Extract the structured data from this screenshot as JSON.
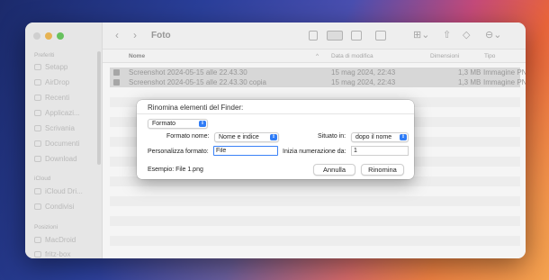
{
  "window": {
    "title": "Foto",
    "traffic_lights": [
      "close",
      "minimize",
      "zoom"
    ]
  },
  "sidebar": {
    "sections": [
      {
        "label": "Preferiti",
        "items": [
          "Setapp",
          "AirDrop",
          "Recenti",
          "Applicazi...",
          "Scrivania",
          "Documenti",
          "Download"
        ]
      },
      {
        "label": "iCloud",
        "items": [
          "iCloud Dri...",
          "Condivisi"
        ]
      },
      {
        "label": "Posizioni",
        "items": [
          "MacDroid",
          "fritz-box"
        ]
      }
    ]
  },
  "toolbar": {
    "back_icon": "chevron-left-icon",
    "forward_icon": "chevron-right-icon",
    "view_icons": [
      "icon-view-icon",
      "list-view-icon",
      "column-view-icon",
      "gallery-view-icon",
      "group-icon",
      "share-icon",
      "tag-icon",
      "more-icon",
      "search-icon"
    ]
  },
  "list": {
    "columns": [
      "Nome",
      "Data di modifica",
      "Dimensioni",
      "Tipo"
    ],
    "rows": [
      {
        "name": "Screenshot 2024-05-15 alle 22.43.30",
        "date": "15 mag 2024, 22:43",
        "size": "1,3 MB",
        "kind": "Immagine PNG"
      },
      {
        "name": "Screenshot 2024-05-15 alle 22.43.30 copia",
        "date": "15 mag 2024, 22:43",
        "size": "1,3 MB",
        "kind": "Immagine PNG"
      }
    ]
  },
  "dialog": {
    "title": "Rinomina elementi del Finder:",
    "mode_value": "Formato",
    "format_name_label": "Formato nome:",
    "format_name_value": "Nome e indice",
    "where_label": "Situato in:",
    "where_value": "dopo il nome",
    "custom_format_label": "Personalizza formato:",
    "custom_format_value": "File",
    "start_numbering_label": "Inizia numerazione da:",
    "start_numbering_value": "1",
    "example_text": "Esempio: File 1.png",
    "cancel_label": "Annulla",
    "rename_label": "Rinomina"
  },
  "colors": {
    "accent": "#2f7cf6",
    "close": "#c9c9c9",
    "minimize": "#e3a93c",
    "zoom": "#52b948"
  }
}
